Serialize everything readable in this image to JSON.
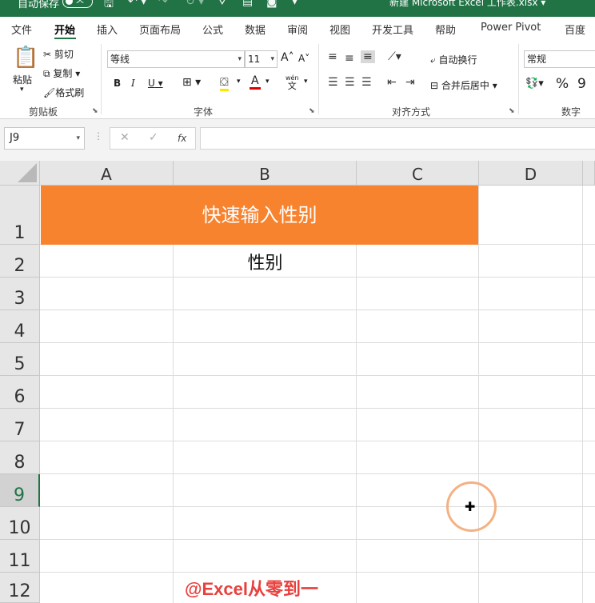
{
  "titlebar": {
    "autosave_label": "自动保存",
    "autosave_state": "关",
    "document_title": "新建 Microsoft Excel 工作表.xlsx"
  },
  "tabs": [
    "文件",
    "开始",
    "插入",
    "页面布局",
    "公式",
    "数据",
    "审阅",
    "视图",
    "开发工具",
    "帮助",
    "Power Pivot",
    "百度网"
  ],
  "active_tab": "开始",
  "ribbon": {
    "clipboard": {
      "paste": "粘贴",
      "cut": "剪切",
      "copy": "复制",
      "format_painter": "格式刷",
      "label": "剪贴板"
    },
    "font": {
      "font_name": "等线",
      "font_size": "11",
      "bold": "B",
      "italic": "I",
      "underline": "U",
      "phonetic": "wén",
      "phonetic_char": "文",
      "label": "字体",
      "increase": "A",
      "decrease": "A",
      "font_color": "A"
    },
    "alignment": {
      "wrap": "自动换行",
      "merge": "合并后居中",
      "label": "对齐方式"
    },
    "number": {
      "format": "常规",
      "percent": "%",
      "comma": "9",
      "label": "数字"
    }
  },
  "formula_bar": {
    "name_box": "J9",
    "fx": "fx",
    "cancel": "✕",
    "enter": "✓",
    "content": ""
  },
  "sheet": {
    "columns": [
      "A",
      "B",
      "C",
      "D"
    ],
    "rows": [
      "1",
      "2",
      "3",
      "4",
      "5",
      "6",
      "7",
      "8",
      "9",
      "10",
      "11",
      "12"
    ],
    "selected_row": "9",
    "title_text": "快速输入性别",
    "b2_text": "性别",
    "watermark": "@Excel从零到一"
  },
  "colors": {
    "excel_green": "#217346",
    "title_fill": "#f8832f",
    "watermark": "#e8403d"
  }
}
